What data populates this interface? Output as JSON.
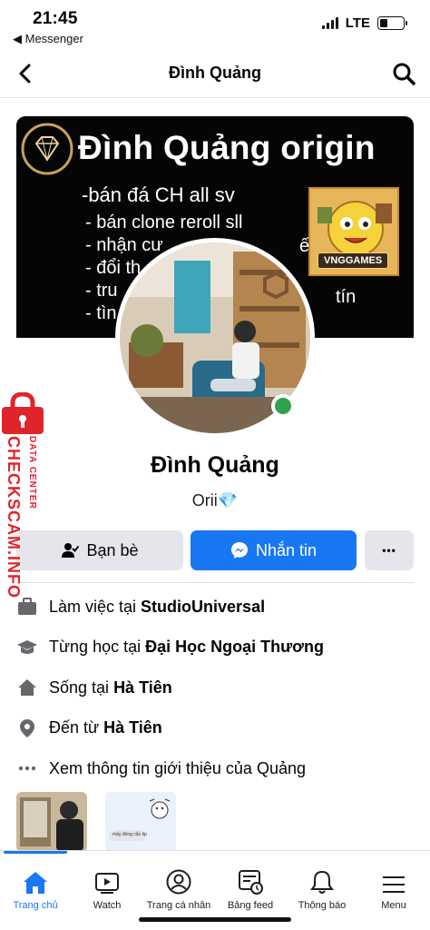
{
  "status_bar": {
    "time": "21:45",
    "back_app": "◀ Messenger",
    "network": "LTE",
    "battery_level": 0.35
  },
  "header": {
    "title": "Đình Quảng",
    "back_icon": "chevron-left-icon",
    "search_icon": "search-icon"
  },
  "cover": {
    "headline": "Đình Quảng origin",
    "lines": [
      "-bán đá CH all sv",
      "- bán clone reroll sll",
      "- nhận cư",
      "- đổi th",
      "- tru",
      "- tìn"
    ],
    "line_tail_3": "ế thuê",
    "line_tail_5": "tín",
    "game_brand": "VNGGAMES"
  },
  "profile": {
    "name": "Đình Quảng",
    "bio": "Orii",
    "bio_emoji": "💎",
    "online": true
  },
  "actions": {
    "friends_label": "Bạn bè",
    "message_label": "Nhắn tin",
    "more_label": "•••"
  },
  "intro": {
    "work_prefix": "Làm việc tại",
    "work_place": "StudioUniversal",
    "school_prefix": "Từng học tại",
    "school": "Đại Học Ngoại Thương",
    "lives_prefix": "Sống tại",
    "lives_in": "Hà Tiên",
    "from_prefix": "Đến từ",
    "from": "Hà Tiên",
    "see_more": "Xem thông tin giới thiệu của Quảng"
  },
  "thumb_text": "mấy đồng cắc tip",
  "watermark": {
    "line1": "DATA CENTER",
    "line2": "CHECKSCAM.INFO"
  },
  "tabs": [
    {
      "label": "Trang chủ",
      "icon": "home-icon",
      "active": true
    },
    {
      "label": "Watch",
      "icon": "watch-icon",
      "active": false
    },
    {
      "label": "Trang cá nhân",
      "icon": "profile-icon",
      "active": false
    },
    {
      "label": "Bảng feed",
      "icon": "feed-icon",
      "active": false
    },
    {
      "label": "Thông báo",
      "icon": "bell-icon",
      "active": false
    },
    {
      "label": "Menu",
      "icon": "menu-icon",
      "active": false
    }
  ],
  "colors": {
    "accent": "#1877f2",
    "online": "#31a24c",
    "button_gray": "#e4e6eb",
    "watermark_red": "#e0242b"
  }
}
